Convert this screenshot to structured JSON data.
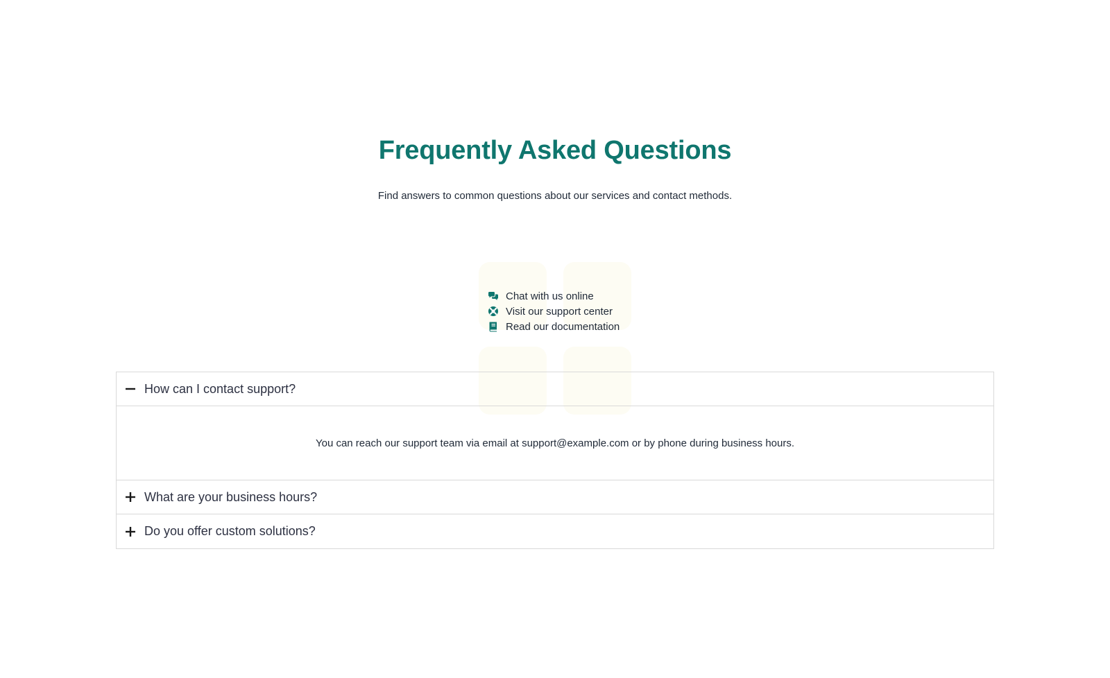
{
  "header": {
    "title": "Frequently Asked Questions",
    "subtitle": "Find answers to common questions about our services and contact methods."
  },
  "contact_methods": [
    {
      "icon": "chat-icon",
      "label": "Chat with us online"
    },
    {
      "icon": "lifebuoy-icon",
      "label": "Visit our support center"
    },
    {
      "icon": "book-icon",
      "label": "Read our documentation"
    }
  ],
  "faq": {
    "items": [
      {
        "question": "How can I contact support?",
        "expanded": true,
        "answer": "You can reach our support team via email at support@example.com or by phone during business hours."
      },
      {
        "question": "What are your business hours?",
        "expanded": false
      },
      {
        "question": "Do you offer custom solutions?",
        "expanded": false
      }
    ]
  },
  "colors": {
    "accent": "#0f766e",
    "text": "#1f2937",
    "border": "#d9d9d9",
    "tile": "#fdfcf3"
  }
}
